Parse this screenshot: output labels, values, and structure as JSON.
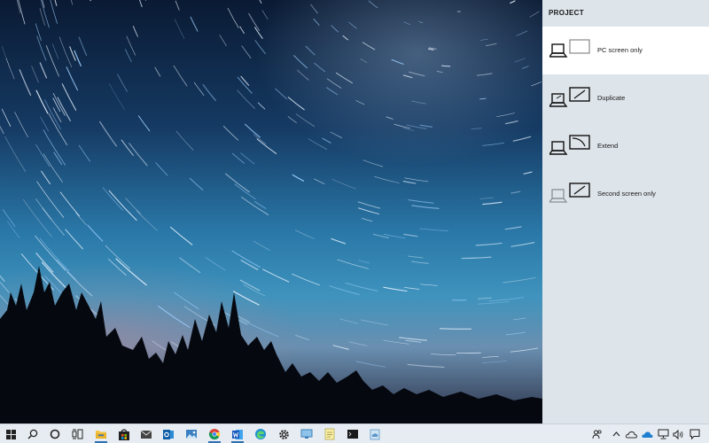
{
  "panel": {
    "title": "PROJECT",
    "options": [
      {
        "label": "PC screen only",
        "selected": true
      },
      {
        "label": "Duplicate",
        "selected": false
      },
      {
        "label": "Extend",
        "selected": false
      },
      {
        "label": "Second screen only",
        "selected": false
      }
    ]
  },
  "taskbar": {
    "apps": [
      "start",
      "search",
      "cortana",
      "task-view",
      "file-explorer",
      "store",
      "mail",
      "outlook",
      "photos",
      "chrome",
      "word",
      "edge",
      "settings",
      "remote-desktop",
      "notepad",
      "terminal",
      "cloud-app"
    ],
    "tray": [
      "people",
      "show-hidden-icons",
      "onedrive",
      "cloud",
      "network",
      "volume",
      "action-center"
    ]
  },
  "colors": {
    "panel_bg": "#dde4ea",
    "selected_bg": "#ffffff",
    "taskbar_bg": "#e6ecf1",
    "accent": "#2f6fb3"
  }
}
